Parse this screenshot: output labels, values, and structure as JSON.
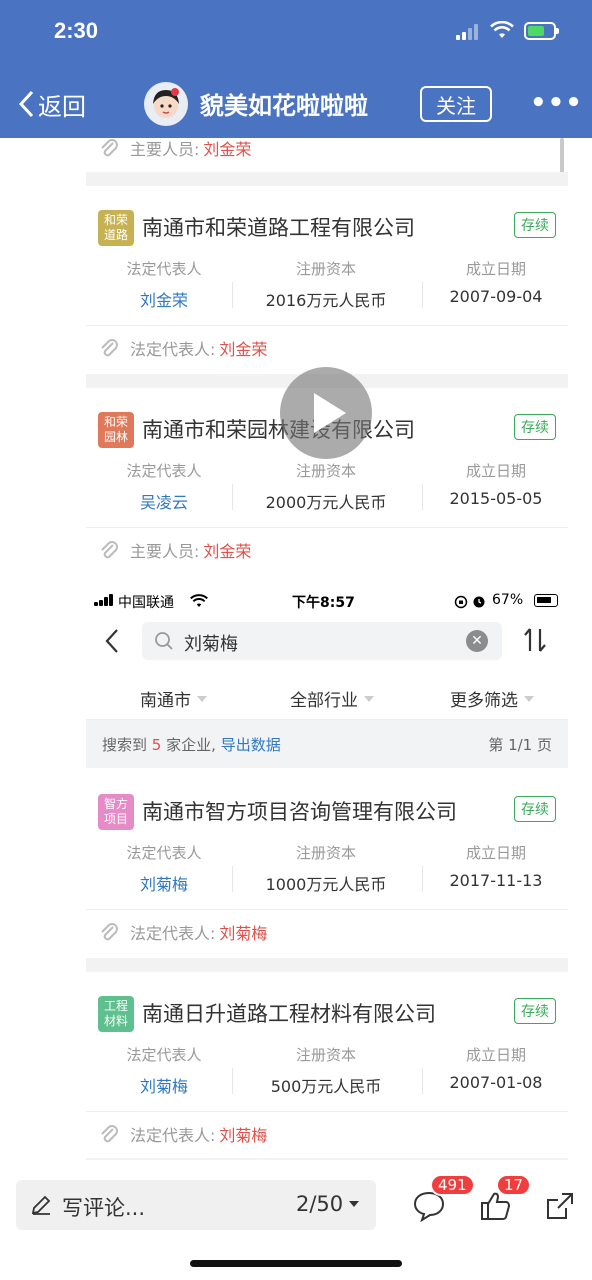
{
  "status_bar": {
    "time": "2:30"
  },
  "nav": {
    "back_label": "返回",
    "title": "貌美如花啦啦啦",
    "follow_label": "关注",
    "more_label": "•••"
  },
  "content": {
    "top_strip": {
      "label": "主要人员:",
      "value": "刘金荣"
    },
    "cards_a": [
      {
        "logo": "和荣\n道路",
        "logo_color": "#c6b253",
        "name": "南通市和荣道路工程有限公司",
        "status": "存续",
        "legal_rep_label": "法定代表人",
        "legal_rep": "刘金荣",
        "capital_label": "注册资本",
        "capital": "2016万元人民币",
        "date_label": "成立日期",
        "date": "2007-09-04",
        "strip_label": "法定代表人:",
        "strip_value": "刘金荣"
      },
      {
        "logo": "和荣\n园林",
        "logo_color": "#e0795a",
        "name": "南通市和荣园林建设有限公司",
        "status": "存续",
        "legal_rep_label": "法定代表人",
        "legal_rep": "吴凌云",
        "capital_label": "注册资本",
        "capital": "2000万元人民币",
        "date_label": "成立日期",
        "date": "2015-05-05",
        "strip_label": "主要人员:",
        "strip_value": "刘金荣"
      }
    ],
    "status_bar_2": {
      "carrier": "中国联通",
      "time": "下午8:57",
      "battery": "67%"
    },
    "search": {
      "query": "刘菊梅"
    },
    "filters": {
      "city": "南通市",
      "industry": "全部行业",
      "more": "更多筛选"
    },
    "results": {
      "prefix": "搜索到",
      "count": "5",
      "suffix": "家企业,",
      "export": "导出数据",
      "page": "第 1/1 页"
    },
    "cards_b": [
      {
        "logo": "智方\n项目",
        "logo_color": "#e58bc8",
        "name": "南通市智方项目咨询管理有限公司",
        "status": "存续",
        "legal_rep_label": "法定代表人",
        "legal_rep": "刘菊梅",
        "capital_label": "注册资本",
        "capital": "1000万元人民币",
        "date_label": "成立日期",
        "date": "2017-11-13",
        "strip_label": "法定代表人:",
        "strip_value": "刘菊梅"
      },
      {
        "logo": "工程\n材料",
        "logo_color": "#5fc08f",
        "name": "南通日升道路工程材料有限公司",
        "status": "存续",
        "legal_rep_label": "法定代表人",
        "legal_rep": "刘菊梅",
        "capital_label": "注册资本",
        "capital": "500万元人民币",
        "date_label": "成立日期",
        "date": "2007-01-08",
        "strip_label": "法定代表人:",
        "strip_value": "刘菊梅"
      }
    ]
  },
  "bottom_bar": {
    "comment_placeholder": "写评论...",
    "page_indicator": "2/50",
    "comment_count": "491",
    "like_count": "17"
  },
  "icons": [
    "back-chevron-icon",
    "avatar",
    "play-icon",
    "paperclip-icon",
    "search-icon",
    "clear-icon",
    "sort-icon",
    "pen-icon",
    "comment-icon",
    "thumbs-up-icon",
    "share-icon"
  ]
}
